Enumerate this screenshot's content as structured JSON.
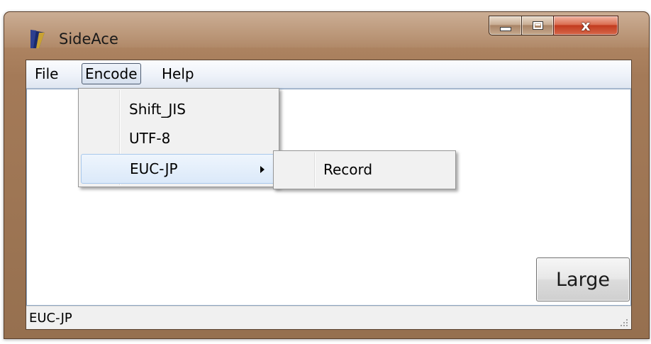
{
  "window": {
    "title": "SideAce",
    "icon": "app-icon",
    "caption_buttons": {
      "minimize": "minimize-icon",
      "maximize": "maximize-icon",
      "close": "x"
    }
  },
  "menubar": {
    "items": [
      {
        "label": "File"
      },
      {
        "label": "Encode"
      },
      {
        "label": "Help"
      }
    ]
  },
  "encode_menu": {
    "items": [
      {
        "label": "Shift_JIS"
      },
      {
        "label": "UTF-8"
      },
      {
        "label": "EUC-JP",
        "has_submenu": true
      }
    ]
  },
  "submenu": {
    "items": [
      {
        "label": "Record"
      }
    ]
  },
  "main": {
    "large_button_label": "Large"
  },
  "statusbar": {
    "text": "EUC-JP"
  },
  "colors": {
    "frame": "#a47a58",
    "close_button": "#c23b1f",
    "highlight": "#dbe9f9"
  }
}
